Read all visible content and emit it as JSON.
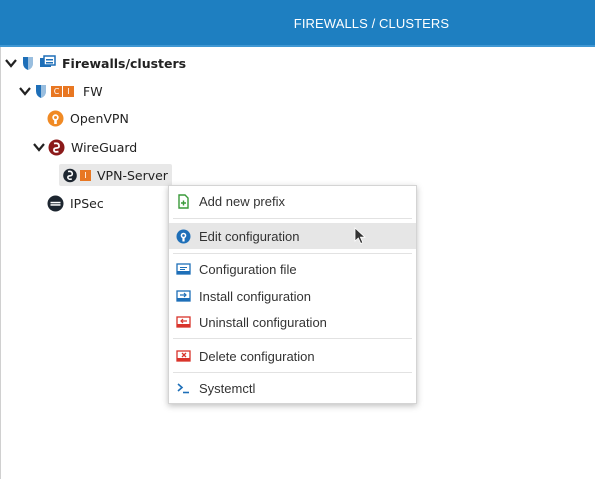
{
  "header": {
    "title": "FIREWALLS / CLUSTERS"
  },
  "tree": {
    "root": {
      "label": "Firewalls/clusters"
    },
    "fw": {
      "label": "FW",
      "badge_c": "C",
      "badge_i": "I"
    },
    "openvpn": {
      "label": "OpenVPN"
    },
    "wireguard": {
      "label": "WireGuard"
    },
    "vpn_server": {
      "label": "VPN-Server",
      "badge_i": "I"
    },
    "ipsec": {
      "label": "IPSec"
    }
  },
  "context_menu": {
    "items": [
      {
        "label": "Add new prefix",
        "icon": "add-prefix-icon"
      },
      {
        "label": "Edit configuration",
        "icon": "edit-config-icon"
      },
      {
        "label": "Configuration file",
        "icon": "config-file-icon"
      },
      {
        "label": "Install configuration",
        "icon": "install-config-icon"
      },
      {
        "label": "Uninstall configuration",
        "icon": "uninstall-config-icon"
      },
      {
        "label": "Delete configuration",
        "icon": "delete-config-icon"
      },
      {
        "label": "Systemctl",
        "icon": "terminal-icon"
      }
    ]
  },
  "colors": {
    "header": "#1e7fc1",
    "openvpn": "#f08a24",
    "wireguard": "#8b1a1a",
    "badge": "#e87722",
    "accent_blue": "#1e6fb8",
    "delete_red": "#d9342b"
  }
}
